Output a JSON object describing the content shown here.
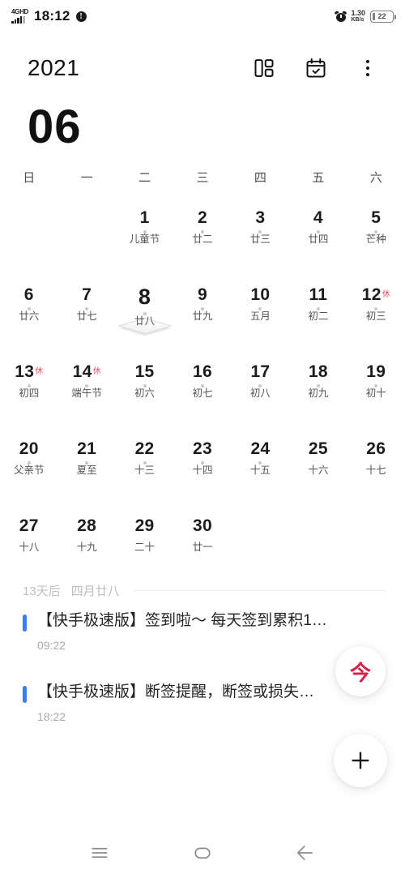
{
  "statusbar": {
    "network_type": "4G",
    "network_hd": "HD",
    "time": "18:12",
    "info_badge": "!",
    "netspeed_value": "1.30",
    "netspeed_unit": "KB/s",
    "battery_percent": "22",
    "icons": [
      "signal-icon",
      "alarm-icon",
      "battery-icon"
    ]
  },
  "header": {
    "year": "2021",
    "view_toggle_icon": "layout-grid-icon",
    "agenda_icon": "calendar-check-icon",
    "overflow_icon": "more-vertical-icon"
  },
  "month": {
    "number": "06"
  },
  "weekdays": [
    "日",
    "一",
    "二",
    "三",
    "四",
    "五",
    "六"
  ],
  "calendar": {
    "leading_blanks": 2,
    "selected_day": "8",
    "days": [
      {
        "day": "1",
        "lunar": "儿童节",
        "dot": true,
        "rest": "",
        "selected": false
      },
      {
        "day": "2",
        "lunar": "廿二",
        "dot": true,
        "rest": "",
        "selected": false
      },
      {
        "day": "3",
        "lunar": "廿三",
        "dot": true,
        "rest": "",
        "selected": false
      },
      {
        "day": "4",
        "lunar": "廿四",
        "dot": true,
        "rest": "",
        "selected": false
      },
      {
        "day": "5",
        "lunar": "芒种",
        "dot": true,
        "rest": "",
        "selected": false
      },
      {
        "day": "6",
        "lunar": "廿六",
        "dot": true,
        "rest": "",
        "selected": false
      },
      {
        "day": "7",
        "lunar": "廿七",
        "dot": true,
        "rest": "",
        "selected": false
      },
      {
        "day": "8",
        "lunar": "廿八",
        "dot": true,
        "rest": "",
        "selected": true
      },
      {
        "day": "9",
        "lunar": "廿九",
        "dot": true,
        "rest": "",
        "selected": false
      },
      {
        "day": "10",
        "lunar": "五月",
        "dot": true,
        "rest": "",
        "selected": false
      },
      {
        "day": "11",
        "lunar": "初二",
        "dot": true,
        "rest": "",
        "selected": false
      },
      {
        "day": "12",
        "lunar": "初三",
        "dot": true,
        "rest": "休",
        "selected": false
      },
      {
        "day": "13",
        "lunar": "初四",
        "dot": true,
        "rest": "休",
        "selected": false
      },
      {
        "day": "14",
        "lunar": "端午节",
        "dot": true,
        "rest": "休",
        "selected": false
      },
      {
        "day": "15",
        "lunar": "初六",
        "dot": true,
        "rest": "",
        "selected": false
      },
      {
        "day": "16",
        "lunar": "初七",
        "dot": true,
        "rest": "",
        "selected": false
      },
      {
        "day": "17",
        "lunar": "初八",
        "dot": true,
        "rest": "",
        "selected": false
      },
      {
        "day": "18",
        "lunar": "初九",
        "dot": true,
        "rest": "",
        "selected": false
      },
      {
        "day": "19",
        "lunar": "初十",
        "dot": true,
        "rest": "",
        "selected": false
      },
      {
        "day": "20",
        "lunar": "父亲节",
        "dot": true,
        "rest": "",
        "selected": false
      },
      {
        "day": "21",
        "lunar": "夏至",
        "dot": true,
        "rest": "",
        "selected": false
      },
      {
        "day": "22",
        "lunar": "十三",
        "dot": true,
        "rest": "",
        "selected": false
      },
      {
        "day": "23",
        "lunar": "十四",
        "dot": true,
        "rest": "",
        "selected": false
      },
      {
        "day": "24",
        "lunar": "十五",
        "dot": true,
        "rest": "",
        "selected": false
      },
      {
        "day": "25",
        "lunar": "十六",
        "dot": false,
        "rest": "",
        "selected": false
      },
      {
        "day": "26",
        "lunar": "十七",
        "dot": false,
        "rest": "",
        "selected": false
      },
      {
        "day": "27",
        "lunar": "十八",
        "dot": false,
        "rest": "",
        "selected": false
      },
      {
        "day": "28",
        "lunar": "十九",
        "dot": false,
        "rest": "",
        "selected": false
      },
      {
        "day": "29",
        "lunar": "二十",
        "dot": false,
        "rest": "",
        "selected": false
      },
      {
        "day": "30",
        "lunar": "廿一",
        "dot": false,
        "rest": "",
        "selected": false
      }
    ]
  },
  "agenda": {
    "relative_label": "13天后",
    "lunar_label": "四月廿八",
    "events": [
      {
        "title": "【快手极速版】签到啦～ 每天签到累积1…",
        "time": "09:22",
        "color": "#3a7bf0"
      },
      {
        "title": "【快手极速版】断签提醒，断签或损失…",
        "time": "18:22",
        "color": "#3a7bf0"
      }
    ]
  },
  "fabs": {
    "today_label": "今",
    "today_color": "#d4234a",
    "add_icon": "plus-icon"
  },
  "navbar": {
    "recents_icon": "menu-icon",
    "home_icon": "home-pill-icon",
    "back_icon": "arrow-left-icon"
  }
}
